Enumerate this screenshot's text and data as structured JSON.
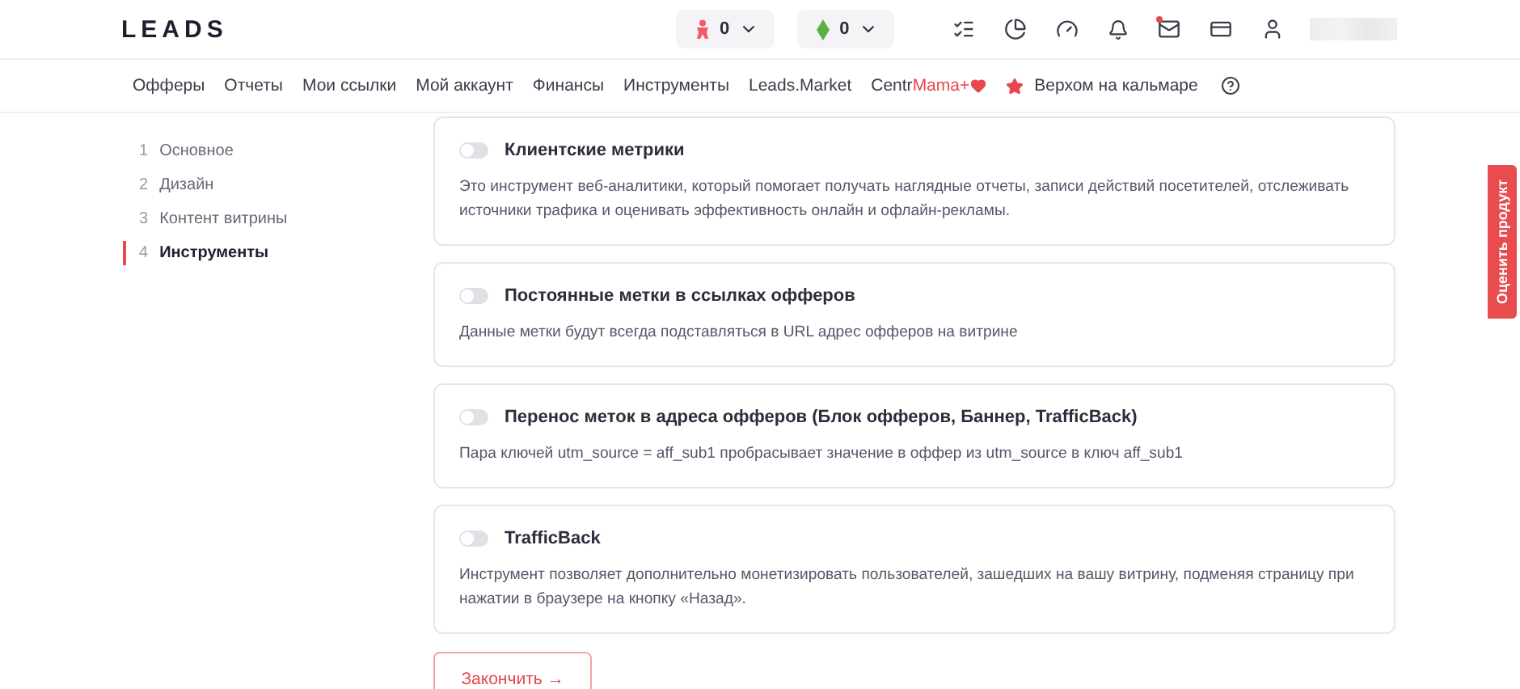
{
  "header": {
    "logo": "LEADS",
    "balances": [
      {
        "kind": "rank",
        "value": "0"
      },
      {
        "kind": "gem",
        "value": "0"
      }
    ],
    "notifications": {
      "mail_unread": true
    }
  },
  "nav": {
    "items": [
      {
        "kind": "plain",
        "label": "Офферы"
      },
      {
        "kind": "plain",
        "label": "Отчеты"
      },
      {
        "kind": "plain",
        "label": "Мои ссылки"
      },
      {
        "kind": "plain",
        "label": "Мой аккаунт"
      },
      {
        "kind": "plain",
        "label": "Финансы"
      },
      {
        "kind": "plain",
        "label": "Инструменты"
      },
      {
        "kind": "plain",
        "label": "Leads.Market"
      },
      {
        "kind": "brand",
        "label": "Centr",
        "accent": "Mama+"
      },
      {
        "kind": "star",
        "label": "Верхом на кальмаре"
      },
      {
        "kind": "help"
      }
    ]
  },
  "steps": [
    {
      "number": "1",
      "label": "Основное",
      "selected": false
    },
    {
      "number": "2",
      "label": "Дизайн",
      "selected": false
    },
    {
      "number": "3",
      "label": "Контент витрины",
      "selected": false
    },
    {
      "number": "4",
      "label": "Инструменты",
      "selected": true
    }
  ],
  "tools": [
    {
      "title": "Клиентские метрики",
      "description": "Это инструмент веб-аналитики, который помогает получать наглядные отчеты, записи действий посетителей, отслеживать источники трафика и оценивать эффективность онлайн и офлайн-рекламы.",
      "on": false
    },
    {
      "title": "Постоянные метки в ссылках офферов",
      "description": "Данные метки будут всегда подставляться в URL адрес офферов на витрине",
      "on": false
    },
    {
      "title": "Перенос меток в адреса офферов (Блок офферов, Баннер, TrafficBack)",
      "description": "Пара ключей utm_source = aff_sub1 пробрасывает значение в оффер из utm_source в ключ aff_sub1",
      "on": false
    },
    {
      "title": "TrafficBack",
      "description": "Инструмент позволяет дополнительно монетизировать пользователей, зашедших на вашу витрину, подменяя страницу при нажатии в браузере на кнопку «Назад».",
      "on": false
    }
  ],
  "finish_button": "Закончить →",
  "feedback_tab": "Оценить продукт"
}
